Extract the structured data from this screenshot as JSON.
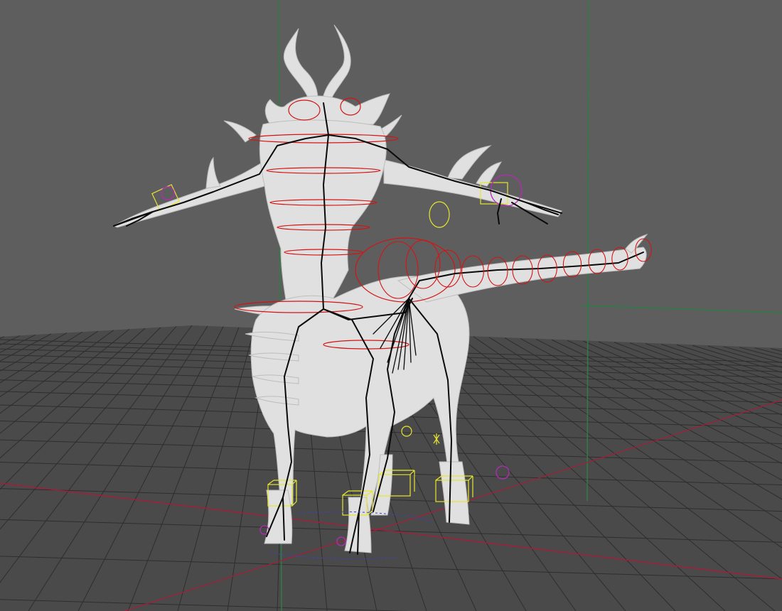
{
  "viewport": {
    "background_color": "#5e5e5e",
    "floor_color": "#4a4a4a",
    "grid_color": "#2f2f2f",
    "x_axis_color": "#a0203a",
    "z_axis_color": "#2e7d46",
    "mesh_color": "#e2e2e2",
    "joint_color": "#0a0a0a",
    "fk_control_color": "#d41414",
    "ik_control_color": "#e6e631",
    "pole_control_color": "#b42bb4"
  }
}
